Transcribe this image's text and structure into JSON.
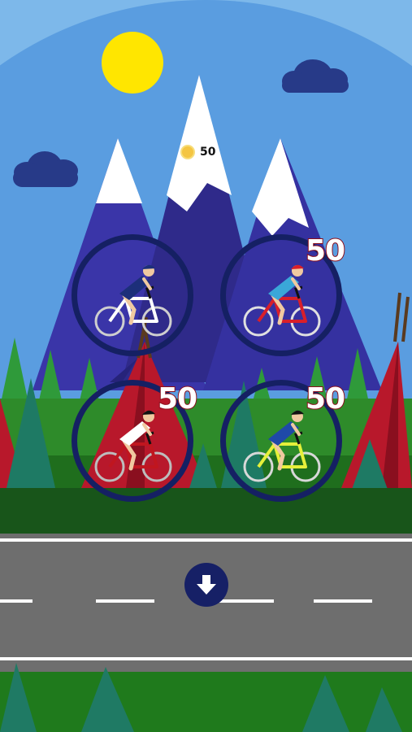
{
  "hud": {
    "coins": "50",
    "coin_icon": "coin-icon"
  },
  "bikes": [
    {
      "id": "bike-1",
      "price": "",
      "jersey": "#1c2f7a",
      "helmet": "#1c2f7a",
      "frame": "#ffffff",
      "wheel": "#cfcfcf"
    },
    {
      "id": "bike-2",
      "price": "50",
      "jersey": "#3aa7d8",
      "helmet": "#d81f2a",
      "frame": "#d81f2a",
      "wheel": "#e0e0e0"
    },
    {
      "id": "bike-3",
      "price": "50",
      "jersey": "#ffffff",
      "helmet": "#111111",
      "frame": "#c0161f",
      "wheel": "#bdbdbd"
    },
    {
      "id": "bike-4",
      "price": "50",
      "jersey": "#1f49a8",
      "helmet": "#111111",
      "frame": "#e6f03a",
      "wheel": "#d8d8d8"
    }
  ],
  "controls": {
    "down_icon": "arrow-down-icon"
  },
  "colors": {
    "sky": "#5a9de0",
    "mountain": "#2f2a8a",
    "snow": "#ffffff",
    "road": "#6e6e6e",
    "grass": "#2e8b2a",
    "ring": "#152063",
    "sun": "#ffe600"
  }
}
